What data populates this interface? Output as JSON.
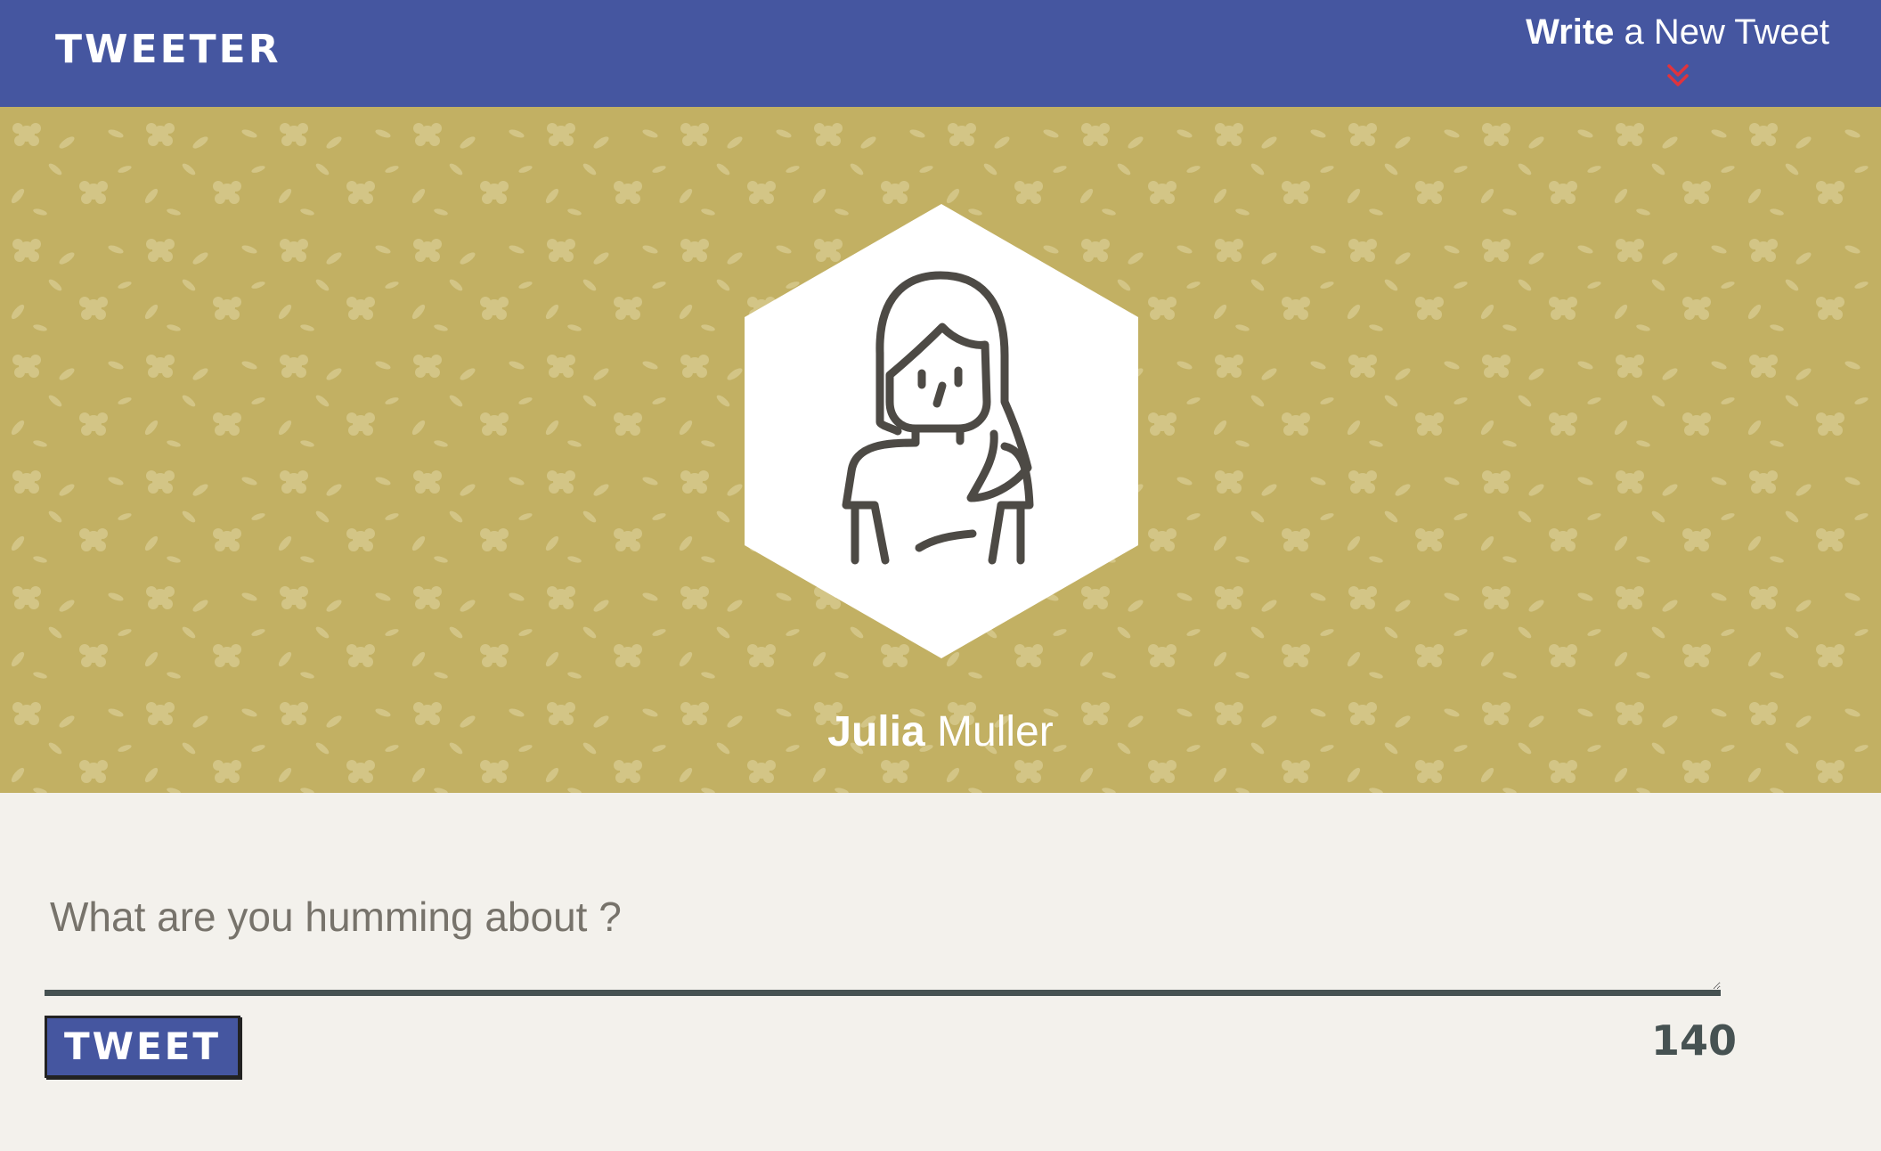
{
  "nav": {
    "brand": "Tweeter",
    "compose_bold": "Write",
    "compose_rest": " a New Tweet",
    "chevron_icon": "double-chevron-down-icon",
    "chevron_color": "#e0333d"
  },
  "profile": {
    "first_name": "Julia",
    "last_name": " Muller",
    "avatar_icon": "woman-avatar-icon"
  },
  "composer": {
    "placeholder": "What are you humming about ?",
    "value": "",
    "submit_label": "Tweet",
    "char_counter": "140"
  },
  "colors": {
    "nav_bg": "#4556a0",
    "header_bg": "#c2b063",
    "page_bg": "#f3f1ec",
    "dark": "#465252"
  }
}
